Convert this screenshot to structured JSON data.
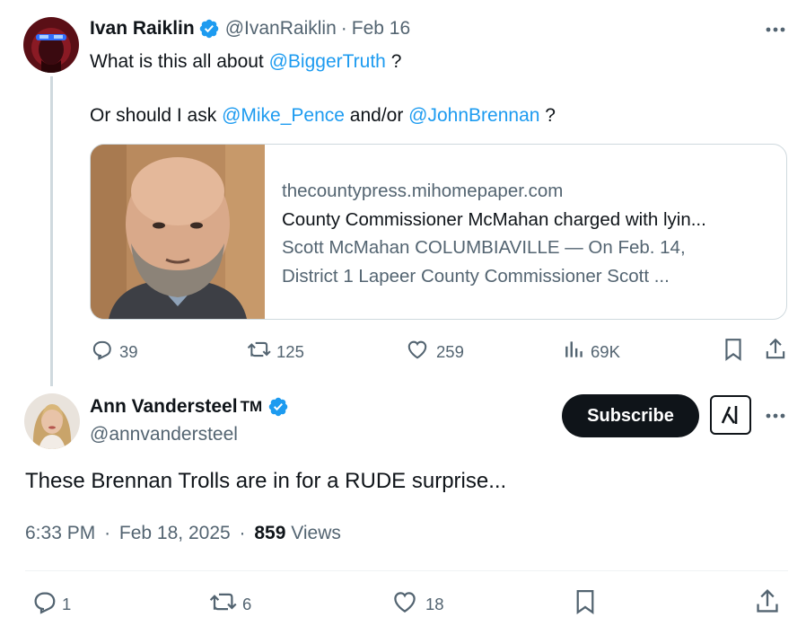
{
  "parent_tweet": {
    "author_name": "Ivan Raiklin",
    "handle": "@IvanRaiklin",
    "separator": "·",
    "date": "Feb 16",
    "line1_prefix": "What is this all about ",
    "line1_mention": "@BiggerTruth",
    "line1_suffix": " ?",
    "line2_prefix": "Or should I ask ",
    "line2_mention1": "@Mike_Pence",
    "line2_middle": " and/or ",
    "line2_mention2": "@JohnBrennan",
    "line2_suffix": " ?",
    "card": {
      "domain": "thecountypress.mihomepaper.com",
      "title": "County Commissioner McMahan charged with lyin...",
      "desc_line1": "Scott McMahan COLUMBIAVILLE — On Feb. 14,",
      "desc_line2": "District 1 Lapeer County Commissioner Scott ..."
    },
    "actions": {
      "replies": "39",
      "reposts": "125",
      "likes": "259",
      "views": "69K"
    }
  },
  "reply_tweet": {
    "author_name": "Ann Vandersteel",
    "tm": "TM",
    "handle": "@annvandersteel",
    "subscribe_label": "Subscribe",
    "text": "These Brennan Trolls are in for a RUDE surprise...",
    "time": "6:33 PM",
    "separator": "·",
    "date": "Feb 18, 2025",
    "views_count": "859",
    "views_label": "Views",
    "actions": {
      "replies": "1",
      "reposts": "6",
      "likes": "18"
    }
  },
  "colors": {
    "accent": "#1d9bf0",
    "muted": "#536471",
    "border": "#cfd9de",
    "verified": "#1d9bf0"
  },
  "icons": [
    "more-icon",
    "verified-badge-icon",
    "reply-icon",
    "repost-icon",
    "like-icon",
    "views-icon",
    "bookmark-icon",
    "share-icon",
    "grok-icon"
  ]
}
